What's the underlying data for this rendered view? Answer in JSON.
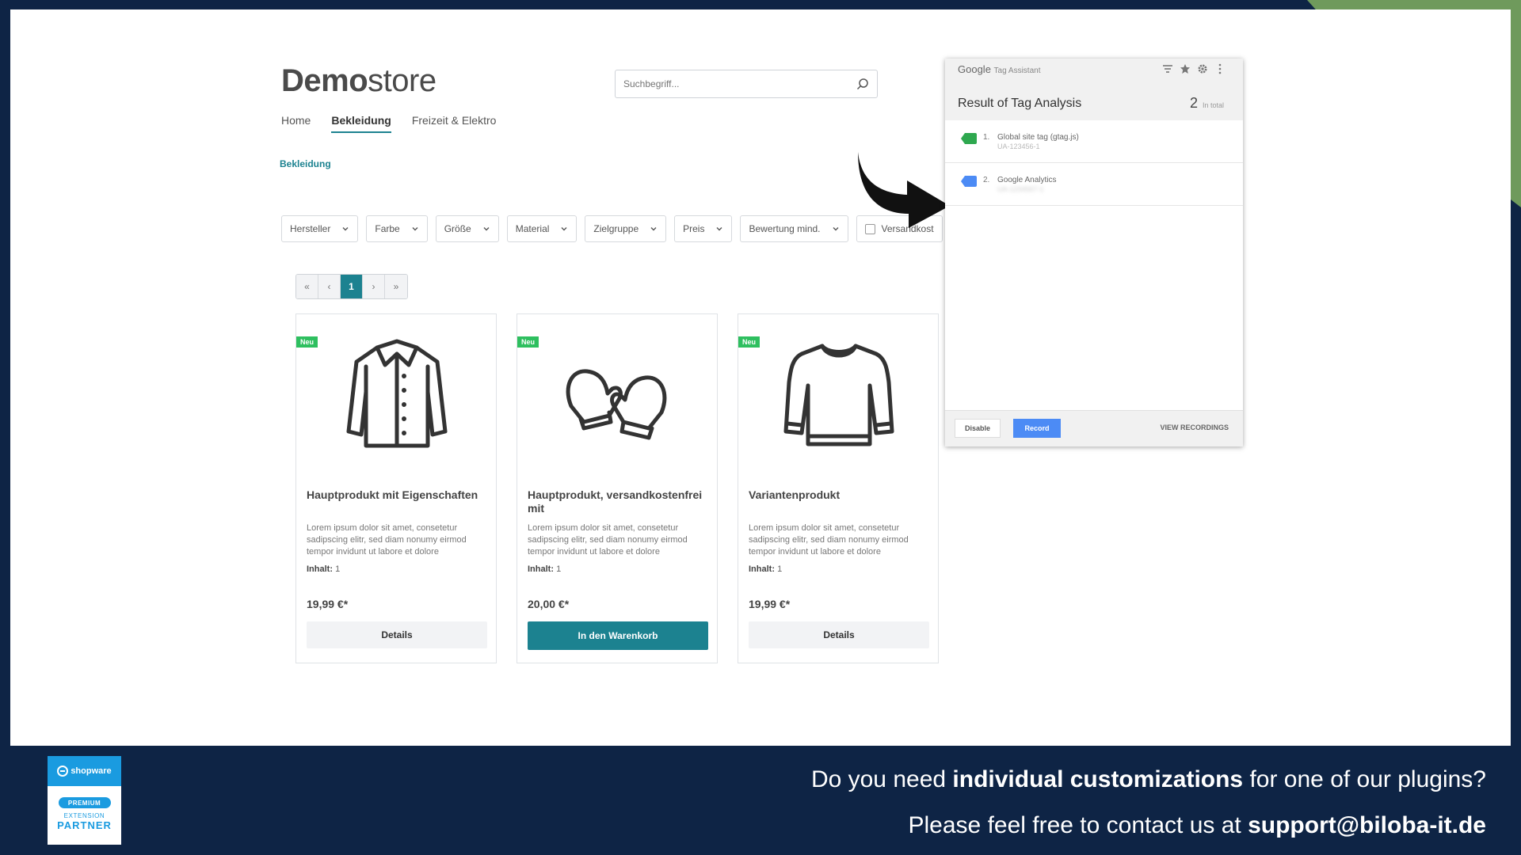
{
  "shop": {
    "logo_bold": "Demo",
    "logo_light": "store",
    "search_placeholder": "Suchbegriff...",
    "nav": [
      "Home",
      "Bekleidung",
      "Freizeit & Elektro"
    ],
    "breadcrumb": "Bekleidung",
    "filters": [
      "Hersteller",
      "Farbe",
      "Größe",
      "Material",
      "Zielgruppe",
      "Preis",
      "Bewertung mind."
    ],
    "filter_checkbox": "Versandkost",
    "pager": [
      "«",
      "‹",
      "1",
      "›",
      "»"
    ],
    "products": [
      {
        "badge": "Neu",
        "title": "Hauptprodukt mit Eigenschaften",
        "desc": "Lorem ipsum dolor sit amet, consetetur sadipscing elitr, sed diam nonumy eirmod tempor invidunt ut labore et dolore",
        "inhalt_label": "Inhalt:",
        "inhalt_value": "1",
        "price": "19,99 €*",
        "button": "Details",
        "icon": "jacket-icon"
      },
      {
        "badge": "Neu",
        "title": "Hauptprodukt, versandkostenfrei mit",
        "desc": "Lorem ipsum dolor sit amet, consetetur sadipscing elitr, sed diam nonumy eirmod tempor invidunt ut labore et dolore",
        "inhalt_label": "Inhalt:",
        "inhalt_value": "1",
        "price": "20,00 €*",
        "button": "In den Warenkorb",
        "icon": "mittens-icon"
      },
      {
        "badge": "Neu",
        "title": "Variantenprodukt",
        "desc": "Lorem ipsum dolor sit amet, consetetur sadipscing elitr, sed diam nonumy eirmod tempor invidunt ut labore et dolore",
        "inhalt_label": "Inhalt:",
        "inhalt_value": "1",
        "price": "19,99 €*",
        "button": "Details",
        "icon": "sweater-icon"
      }
    ]
  },
  "tag_assistant": {
    "brand": "Google",
    "brand_sub": "Tag Assistant",
    "heading": "Result of Tag Analysis",
    "count": "2",
    "count_label": "In total",
    "tags": [
      {
        "num": "1.",
        "name": "Global site tag (gtag.js)",
        "sub": "UA-123456-1",
        "color": "#2ea84f"
      },
      {
        "num": "2.",
        "name": "Google Analytics",
        "sub": "UA-1234567-1",
        "color": "#4c8bf5"
      }
    ],
    "disable": "Disable",
    "record": "Record",
    "view_recordings": "VIEW RECORDINGS"
  },
  "footer": {
    "partner_brand": "shopware",
    "partner_pill": "PREMIUM",
    "partner_ext": "EXTENSION",
    "partner_label": "PARTNER",
    "line1_pre": "Do you need ",
    "line1_bold": "individual customizations",
    "line1_post": " for one of our plugins?",
    "line2_pre": "Please feel free to contact us at ",
    "line2_bold": "support@biloba-it.de"
  },
  "colors": {
    "background": "#0e2445",
    "accent_green": "#6f9a5c",
    "shop_teal": "#1c8290",
    "google_blue": "#4c8bf5",
    "shopware_blue": "#1a9be0"
  }
}
